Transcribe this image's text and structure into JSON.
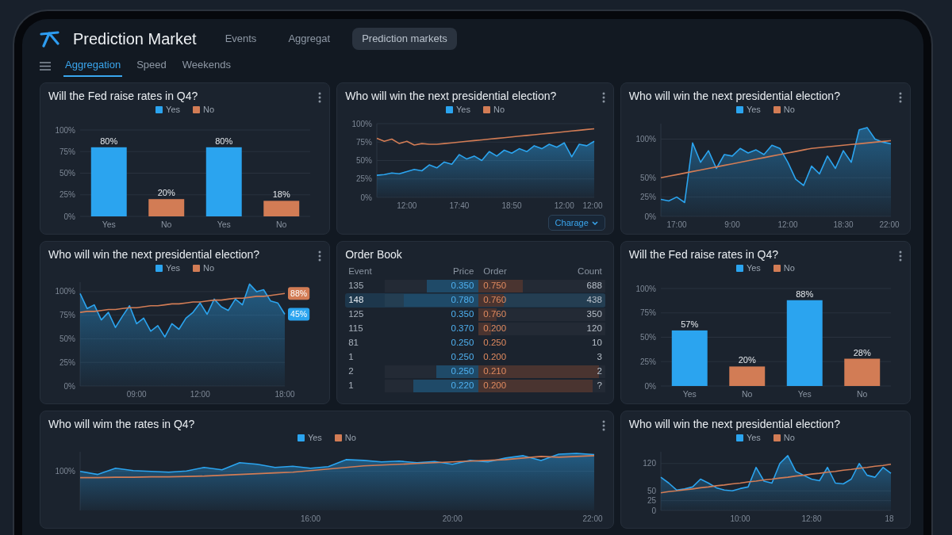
{
  "header": {
    "title": "Prediction Market",
    "nav": [
      {
        "label": "Events",
        "selected": false
      },
      {
        "label": "Aggregat",
        "selected": false
      },
      {
        "label": "Prediction markets",
        "selected": true
      }
    ]
  },
  "subtabs": [
    {
      "label": "Aggregation",
      "selected": true
    },
    {
      "label": "Speed",
      "selected": false
    },
    {
      "label": "Weekends",
      "selected": false
    }
  ],
  "panels": [
    {
      "kind": "chart",
      "title": "Will the Fed raise rates in Q4?",
      "menu": true,
      "chart_data": {
        "type": "bar",
        "grid": true,
        "categories": [
          "Yes",
          "No",
          "Yes",
          "No"
        ],
        "series": [
          {
            "name": "Yes",
            "color": "#2ba4ef",
            "values": [
              80,
              null,
              80,
              null
            ]
          },
          {
            "name": "No",
            "color": "#d27c55",
            "values": [
              null,
              20,
              null,
              18
            ]
          }
        ],
        "ylim": [
          0,
          100
        ],
        "yticks": [
          {
            "value": 0,
            "label": "0%"
          },
          {
            "value": 25,
            "label": "25%"
          },
          {
            "value": 50,
            "label": "50%"
          },
          {
            "value": 75,
            "label": "75%"
          },
          {
            "value": 100,
            "label": "100%"
          }
        ],
        "value_labels": [
          "80%",
          "20%",
          "80%",
          "18%"
        ]
      }
    },
    {
      "kind": "chart",
      "title": "Who will win the next presidential election?",
      "menu": true,
      "action": {
        "label": "Charage"
      },
      "chart_data": {
        "type": "area",
        "grid": true,
        "categories": [
          null,
          null,
          null,
          null,
          "12:00",
          null,
          null,
          null,
          null,
          null,
          null,
          "17:40",
          null,
          null,
          null,
          null,
          null,
          null,
          "18:50",
          null,
          null,
          null,
          null,
          null,
          null,
          "12:00",
          null,
          null,
          null,
          "12:00"
        ],
        "series": [
          {
            "name": "Yes",
            "color": "#2ba4ef",
            "type": "area",
            "values": [
              30,
              31,
              33,
              32,
              35,
              38,
              36,
              44,
              40,
              48,
              45,
              58,
              52,
              56,
              50,
              62,
              56,
              64,
              60,
              66,
              62,
              70,
              66,
              72,
              68,
              74,
              55,
              72,
              70,
              76
            ]
          },
          {
            "name": "No",
            "color": "#d27c55",
            "type": "line",
            "values": [
              80,
              76,
              79,
              73,
              76,
              71,
              73,
              72,
              72,
              73,
              74,
              75,
              76,
              77,
              78,
              79,
              80,
              81,
              82,
              83,
              84,
              85,
              86,
              87,
              88,
              89,
              90,
              91,
              92,
              93
            ]
          }
        ],
        "ylim": [
          0,
          100
        ],
        "yticks": [
          {
            "value": 0,
            "label": "0%"
          },
          {
            "value": 25,
            "label": "25%"
          },
          {
            "value": 50,
            "label": "50%"
          },
          {
            "value": 75,
            "label": "75%"
          },
          {
            "value": 100,
            "label": "100%"
          }
        ]
      }
    },
    {
      "kind": "chart",
      "title": "Who will win the next presidential election?",
      "menu": true,
      "chart_data": {
        "type": "area",
        "grid": true,
        "categories": [
          null,
          null,
          "17:00",
          null,
          null,
          null,
          null,
          null,
          null,
          "9:00",
          null,
          null,
          null,
          null,
          null,
          null,
          "12:00",
          null,
          null,
          null,
          null,
          null,
          null,
          "18:30",
          null,
          null,
          null,
          null,
          null,
          "22:00"
        ],
        "series": [
          {
            "name": "Yes",
            "color": "#2ba4ef",
            "type": "area",
            "values": [
              22,
              20,
              25,
              18,
              95,
              70,
              85,
              62,
              80,
              78,
              88,
              82,
              86,
              80,
              92,
              88,
              70,
              48,
              40,
              65,
              55,
              78,
              62,
              85,
              70,
              112,
              115,
              100,
              96,
              94
            ]
          },
          {
            "name": "No",
            "color": "#d27c55",
            "type": "line",
            "values": [
              50,
              52,
              54,
              56,
              58,
              60,
              62,
              64,
              66,
              68,
              70,
              72,
              74,
              76,
              78,
              80,
              82,
              84,
              86,
              88,
              89,
              90,
              91,
              92,
              93,
              94,
              95,
              96,
              97,
              98
            ]
          }
        ],
        "ylim": [
          0,
          120
        ],
        "yticks": [
          {
            "value": 0,
            "label": "0%"
          },
          {
            "value": 25,
            "label": "25%"
          },
          {
            "value": 50,
            "label": "50%"
          },
          {
            "value": 100,
            "label": "100%"
          }
        ]
      }
    },
    {
      "kind": "chart",
      "title": "Who will win the next presidential election?",
      "menu": true,
      "chart_data": {
        "type": "area",
        "grid": true,
        "categories": [
          null,
          null,
          null,
          null,
          null,
          null,
          null,
          null,
          "09:00",
          null,
          null,
          null,
          null,
          null,
          null,
          null,
          null,
          "12:00",
          null,
          null,
          null,
          null,
          null,
          null,
          null,
          null,
          null,
          null,
          null,
          "18:00"
        ],
        "series": [
          {
            "name": "Yes",
            "color": "#2ba4ef",
            "type": "area",
            "values": [
              98,
              82,
              86,
              70,
              78,
              62,
              74,
              85,
              66,
              72,
              58,
              64,
              52,
              66,
              60,
              72,
              78,
              88,
              76,
              92,
              84,
              80,
              92,
              86,
              108,
              100,
              102,
              90,
              88,
              76
            ]
          },
          {
            "name": "No",
            "color": "#d27c55",
            "type": "line",
            "values": [
              78,
              79,
              79,
              80,
              81,
              81,
              82,
              83,
              83,
              84,
              85,
              85,
              86,
              87,
              87,
              88,
              89,
              89,
              90,
              91,
              91,
              92,
              93,
              93,
              94,
              95,
              95,
              96,
              97,
              98
            ]
          }
        ],
        "ylim": [
          0,
          110
        ],
        "yticks": [
          {
            "value": 0,
            "label": "0%"
          },
          {
            "value": 25,
            "label": "25%"
          },
          {
            "value": 50,
            "label": "50%"
          },
          {
            "value": 75,
            "label": "75%"
          },
          {
            "value": 100,
            "label": "100%"
          }
        ],
        "annotations": [
          "88%",
          "45%"
        ]
      }
    },
    {
      "kind": "order_book",
      "title": "Order Book",
      "columns": [
        "Event",
        "Price",
        "Order",
        "Count"
      ],
      "rows": [
        {
          "event": "135",
          "price": "0.350",
          "order": "0.750",
          "count": "688",
          "bid_depth": {
            "level": 0.55
          },
          "ask_depth": {
            "level": 0.35
          },
          "selected": false
        },
        {
          "event": "148",
          "price": "0.780",
          "order": "0.760",
          "count": "438",
          "bid_depth": {
            "level": 0.8
          },
          "ask_depth": {
            "level": 0.2
          },
          "selected": true
        },
        {
          "event": "125",
          "price": "0.350",
          "order": "0.760",
          "count": "350",
          "ask_depth": {
            "level": 0.14
          },
          "selected": false
        },
        {
          "event": "115",
          "price": "0.370",
          "order": "0.200",
          "count": "120",
          "ask_depth": {
            "level": 0.1
          },
          "selected": false
        },
        {
          "event": "81",
          "price": "0.250",
          "order": "0.250",
          "count": "10",
          "selected": false
        },
        {
          "event": "1",
          "price": "0.250",
          "order": "0.200",
          "count": "3",
          "selected": false
        },
        {
          "event": "2",
          "price": "0.250",
          "order": "0.210",
          "count": "2",
          "bid_depth": {
            "level": 0.45
          },
          "ask_depth": {
            "level": 0.95
          },
          "selected": false
        },
        {
          "event": "1",
          "price": "0.220",
          "order": "0.200",
          "count": "?",
          "bid_depth": {
            "level": 0.7
          },
          "ask_depth": {
            "level": 0.9
          },
          "selected": false
        }
      ]
    },
    {
      "kind": "chart",
      "title": "Will the Fed raise rates in Q4?",
      "menu": true,
      "chart_data": {
        "type": "bar",
        "grid": true,
        "categories": [
          "Yes",
          "No",
          "Yes",
          "No"
        ],
        "series": [
          {
            "name": "Yes",
            "color": "#2ba4ef",
            "values": [
              57,
              null,
              88,
              null
            ]
          },
          {
            "name": "No",
            "color": "#d27c55",
            "values": [
              null,
              20,
              null,
              28
            ]
          }
        ],
        "ylim": [
          0,
          100
        ],
        "yticks": [
          {
            "value": 0,
            "label": "0%"
          },
          {
            "value": 25,
            "label": "25%"
          },
          {
            "value": 50,
            "label": "50%"
          },
          {
            "value": 75,
            "label": "75%"
          },
          {
            "value": 100,
            "label": "100%"
          }
        ],
        "value_labels": [
          "57%",
          "20%",
          "88%",
          "28%"
        ]
      }
    },
    {
      "kind": "chart",
      "title": "Who will wim the rates in Q4?",
      "menu": true,
      "chart_data": {
        "type": "area",
        "grid": true,
        "categories": [
          null,
          null,
          null,
          null,
          null,
          null,
          null,
          null,
          null,
          null,
          null,
          null,
          null,
          "16:00",
          null,
          null,
          null,
          null,
          null,
          null,
          null,
          "20:00",
          null,
          null,
          null,
          null,
          null,
          null,
          null,
          "22:00"
        ],
        "series": [
          {
            "name": "Yes",
            "color": "#2ba4ef",
            "type": "area",
            "values": [
              100,
              92,
              108,
              102,
              100,
              98,
              101,
              110,
              104,
              122,
              118,
              110,
              113,
              108,
              112,
              130,
              128,
              124,
              126,
              122,
              125,
              118,
              128,
              124,
              134,
              140,
              128,
              144,
              146,
              143
            ]
          },
          {
            "name": "No",
            "color": "#d27c55",
            "type": "line",
            "values": [
              84,
              84,
              85,
              85,
              86,
              86,
              87,
              88,
              90,
              92,
              94,
              96,
              98,
              102,
              106,
              110,
              114,
              116,
              118,
              120,
              122,
              124,
              126,
              128,
              130,
              134,
              138,
              136,
              138,
              140
            ]
          }
        ],
        "ylim": [
          0,
          150
        ],
        "yticks": [
          {
            "value": 100,
            "label": "100%"
          }
        ]
      }
    },
    {
      "kind": "chart",
      "title": "Who will win the next presidential election?",
      "chart_data": {
        "type": "area",
        "grid": true,
        "categories": [
          null,
          null,
          null,
          null,
          null,
          null,
          null,
          null,
          null,
          null,
          "10:00",
          null,
          null,
          null,
          null,
          null,
          null,
          null,
          null,
          "12:80",
          null,
          null,
          null,
          null,
          null,
          null,
          null,
          null,
          null,
          "18"
        ],
        "series": [
          {
            "name": "Yes",
            "color": "#2ba4ef",
            "type": "area",
            "values": [
              85,
              70,
              52,
              55,
              60,
              80,
              70,
              58,
              52,
              50,
              56,
              60,
              110,
              75,
              70,
              120,
              140,
              100,
              90,
              80,
              76,
              110,
              70,
              68,
              80,
              120,
              90,
              85,
              110,
              95
            ]
          },
          {
            "name": "No",
            "color": "#d27c55",
            "type": "line",
            "values": [
              45,
              48,
              50,
              53,
              55,
              58,
              60,
              63,
              65,
              68,
              70,
              73,
              75,
              78,
              80,
              83,
              85,
              88,
              90,
              93,
              95,
              98,
              100,
              103,
              105,
              108,
              110,
              113,
              115,
              118
            ]
          }
        ],
        "ylim": [
          0,
          150
        ],
        "yticks": [
          {
            "value": 0,
            "label": "0"
          },
          {
            "value": 25,
            "label": "25"
          },
          {
            "value": 50,
            "label": "50"
          },
          {
            "value": 120,
            "label": "120"
          }
        ]
      }
    }
  ]
}
